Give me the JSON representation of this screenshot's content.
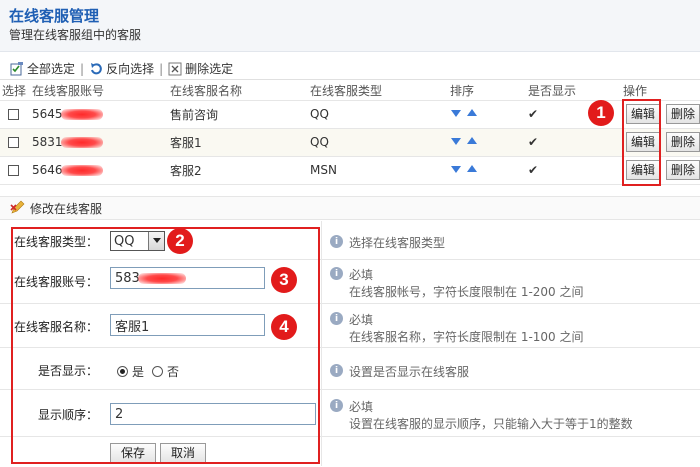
{
  "header": {
    "title": "在线客服管理",
    "subtitle": "管理在线客服组中的客服"
  },
  "toolbar": {
    "select_all": "全部选定",
    "invert": "反向选择",
    "delete": "删除选定",
    "sep": "|"
  },
  "table": {
    "columns": [
      "选择",
      "在线客服账号",
      "在线客服名称",
      "在线客服类型",
      "排序",
      "是否显示",
      "操作"
    ],
    "rows": [
      {
        "account": "5645",
        "name": "售前咨询",
        "type": "QQ",
        "visible": "✔",
        "edit": "编辑",
        "delete": "删除"
      },
      {
        "account": "5831",
        "name": "客服1",
        "type": "QQ",
        "visible": "✔",
        "edit": "编辑",
        "delete": "删除"
      },
      {
        "account": "5646",
        "name": "客服2",
        "type": "MSN",
        "visible": "✔",
        "edit": "编辑",
        "delete": "删除"
      }
    ]
  },
  "section": {
    "title": "修改在线客服"
  },
  "form": {
    "type_label": "在线客服类型：",
    "type_value": "QQ",
    "type_hint": "选择在线客服类型",
    "account_label": "在线客服账号：",
    "account_value": "583",
    "account_hint_1": "必填",
    "account_hint_2": "在线客服帐号，字符长度限制在  1-200 之间",
    "name_label": "在线客服名称：",
    "name_value": "客服1",
    "name_hint_1": "必填",
    "name_hint_2": "在线客服名称，字符长度限制在  1-100 之间",
    "show_label": "是否显示：",
    "show_yes": "是",
    "show_no": "否",
    "show_hint": "设置是否显示在线客服",
    "order_label": "显示顺序：",
    "order_value": "2",
    "order_hint_1": "必填",
    "order_hint_2": "设置在线客服的显示顺序，只能输入大于等于1的整数",
    "save": "保存",
    "cancel": "取消"
  },
  "badges": [
    "1",
    "2",
    "3",
    "4"
  ],
  "colors": {
    "accent": "#1f5fb4",
    "annotation": "#e21b1b"
  }
}
